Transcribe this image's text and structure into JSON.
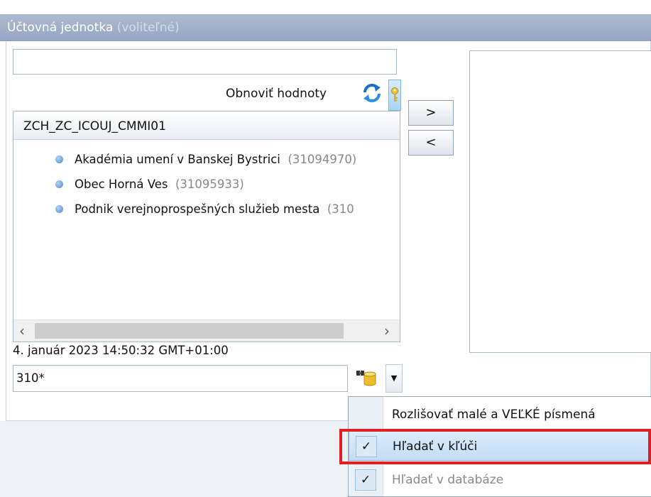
{
  "header": {
    "title": "Účtovná jednotka",
    "optional": "(voliteľné)"
  },
  "refresh": {
    "label": "Obnoviť hodnoty"
  },
  "list": {
    "header": "ZCH_ZC_ICOUJ_CMMI01",
    "items": [
      {
        "name": "Akadémia umení v Banskej Bystrici",
        "code": "(31094970)"
      },
      {
        "name": "Obec Horná Ves",
        "code": "(31095933)"
      },
      {
        "name": "Podnik verejnoprospešných služieb mesta",
        "code": "(310"
      }
    ]
  },
  "buttons": {
    "move_right": ">",
    "move_left": "<"
  },
  "timestamp": "4. január 2023 14:50:32 GMT+01:00",
  "search": {
    "value": "310*"
  },
  "menu": {
    "items": [
      {
        "label": "Rozlišovať malé a VEĽKÉ písmená",
        "checked": false,
        "state": "normal"
      },
      {
        "label": "Hľadať v kľúči",
        "checked": true,
        "state": "hover"
      },
      {
        "label": "Hľadať v databáze",
        "checked": true,
        "state": "disabled"
      }
    ]
  },
  "colors": {
    "header_bg": "#95a5c2",
    "highlight": "#e02020",
    "menu_hover": "#c3ddf6"
  }
}
